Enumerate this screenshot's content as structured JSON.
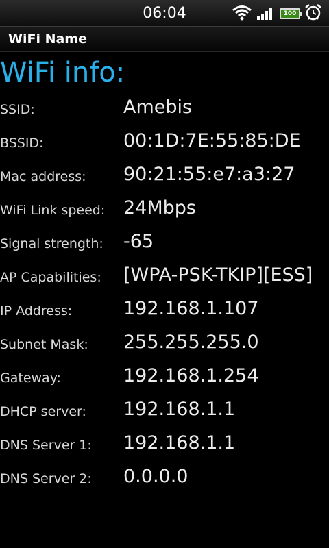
{
  "status_bar": {
    "time": "06:04",
    "battery_level": "100",
    "icons": [
      "wifi-icon",
      "signal-icon",
      "battery-icon",
      "alarm-icon"
    ]
  },
  "title_bar": {
    "title": "WiFi Name"
  },
  "main": {
    "heading": "WiFi info:",
    "rows": [
      {
        "label": "SSID:",
        "value": "Amebis"
      },
      {
        "label": "BSSID:",
        "value": "00:1D:7E:55:85:DE"
      },
      {
        "label": "Mac address:",
        "value": "90:21:55:e7:a3:27"
      },
      {
        "label": "WiFi Link speed:",
        "value": "24Mbps"
      },
      {
        "label": "Signal strength:",
        "value": "-65"
      },
      {
        "label": "AP Capabilities:",
        "value": "[WPA-PSK-TKIP][ESS]"
      },
      {
        "label": "IP Address:",
        "value": "192.168.1.107"
      },
      {
        "label": "Subnet Mask:",
        "value": "255.255.255.0"
      },
      {
        "label": "Gateway:",
        "value": "192.168.1.254"
      },
      {
        "label": "DHCP server:",
        "value": "192.168.1.1"
      },
      {
        "label": "DNS Server 1:",
        "value": "192.168.1.1"
      },
      {
        "label": "DNS Server 2:",
        "value": "0.0.0.0"
      }
    ]
  },
  "colors": {
    "accent": "#2ab0e8",
    "background": "#000000",
    "text": "#e6e6e6"
  }
}
